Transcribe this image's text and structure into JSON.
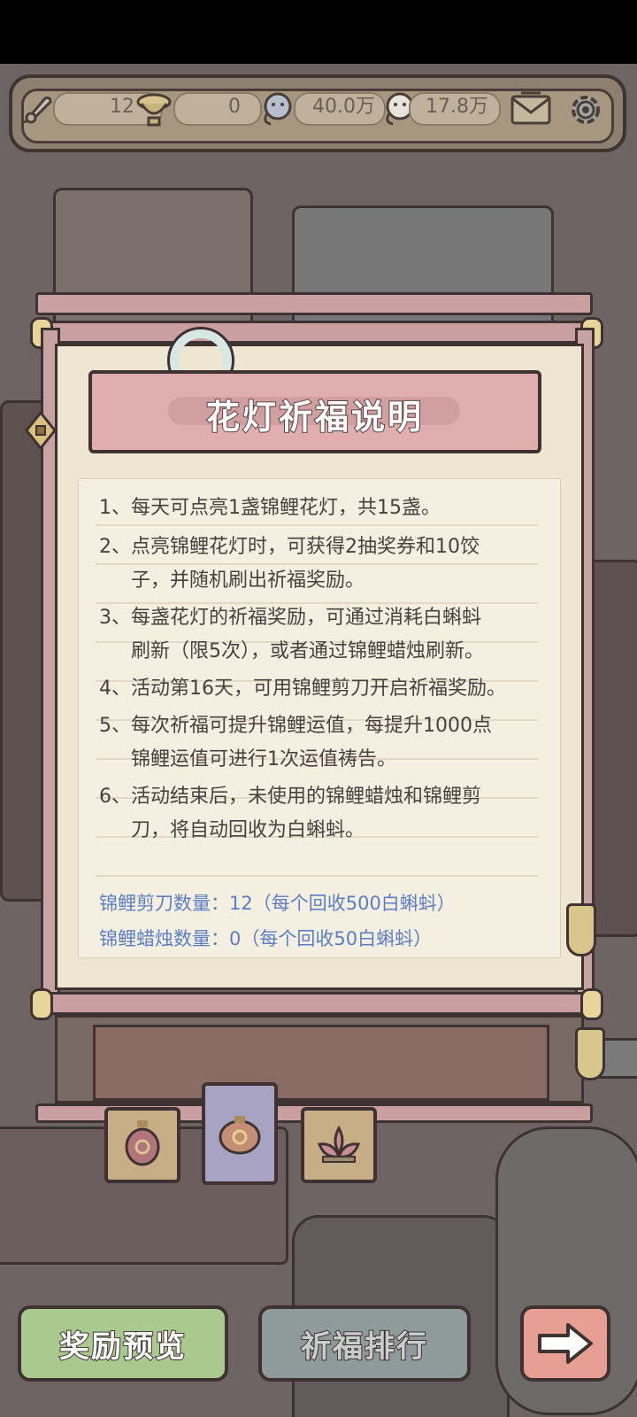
{
  "topbar": {
    "resource_1_value": "12",
    "resource_2_value": "0",
    "resource_3_value": "40.0万",
    "resource_4_value": "17.8万"
  },
  "rules": {
    "title": "花灯祈福说明",
    "items": [
      "1、每天可点亮1盏锦鲤花灯，共15盏。",
      "2、点亮锦鲤花灯时，可获得2抽奖券和10饺",
      "子，并随机刷出祈福奖励。",
      "3、每盏花灯的祈福奖励，可通过消耗白蝌蚪",
      "刷新（限5次），或者通过锦鲤蜡烛刷新。",
      "4、活动第16天，可用锦鲤剪刀开启祈福奖励。",
      "5、每次祈福可提升锦鲤运值，每提升1000点",
      "锦鲤运值可进行1次运值祷告。",
      "6、活动结束后，未使用的锦鲤蜡烛和锦鲤剪",
      "刀，将自动回收为白蝌蚪。"
    ],
    "scissors_count": "锦鲤剪刀数量：12（每个回收500白蝌蚪）",
    "candle_count": "锦鲤蜡烛数量：0（每个回收50白蝌蚪）"
  },
  "buttons": {
    "reward_preview": "奖励预览",
    "blessing_rank": "祈福排行"
  },
  "colors": {
    "accent_blue": "#5b7fc4",
    "banner_pink": "#e1aeb0",
    "preview_green": "#a9c98f",
    "rank_gray": "#8f9a9a",
    "next_pink": "#e79f94"
  }
}
